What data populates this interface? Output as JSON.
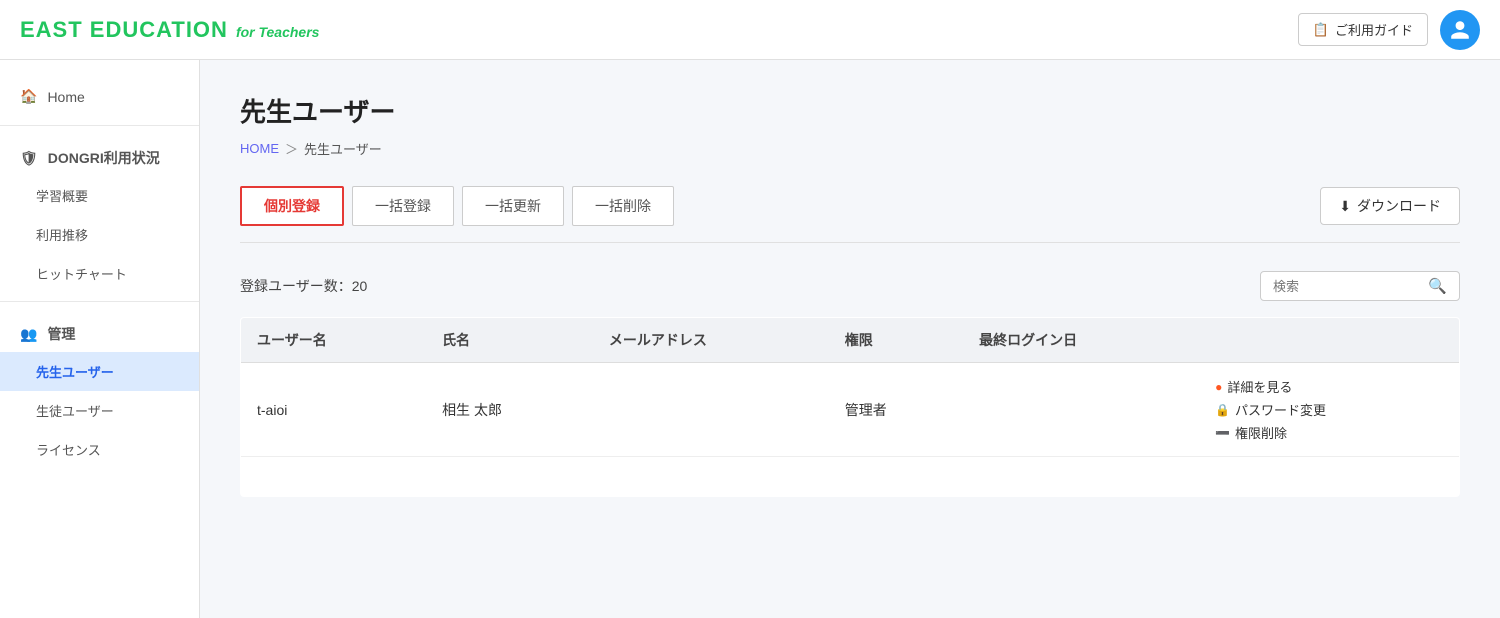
{
  "header": {
    "logo_main": "EAST EDUCATION",
    "logo_sub": "for Teachers",
    "guide_icon": "📋",
    "guide_label": "ご利用ガイド"
  },
  "sidebar": {
    "home_label": "Home",
    "dongri_label": "DONGRI利用状況",
    "sub_items": [
      {
        "label": "学習概要",
        "active": false
      },
      {
        "label": "利用推移",
        "active": false
      },
      {
        "label": "ヒットチャート",
        "active": false
      }
    ],
    "management_label": "管理",
    "management_sub": [
      {
        "label": "先生ユーザー",
        "active": true
      },
      {
        "label": "生徒ユーザー",
        "active": false
      },
      {
        "label": "ライセンス",
        "active": false
      }
    ]
  },
  "page": {
    "title": "先生ユーザー",
    "breadcrumb_home": "HOME",
    "breadcrumb_current": "先生ユーザー"
  },
  "tabs": [
    {
      "label": "個別登録",
      "active": true
    },
    {
      "label": "一括登録",
      "active": false
    },
    {
      "label": "一括更新",
      "active": false
    },
    {
      "label": "一括削除",
      "active": false
    }
  ],
  "download_label": "ダウンロード",
  "user_count_label": "登録ユーザー数：20",
  "search_placeholder": "検索",
  "table": {
    "columns": [
      "ユーザー名",
      "氏名",
      "メールアドレス",
      "権限",
      "最終ログイン日",
      ""
    ],
    "rows": [
      {
        "username": "t-aioi",
        "fullname": "相生 太郎",
        "email": "",
        "role": "管理者",
        "last_login": "",
        "actions": [
          "詳細を見る",
          "パスワード変更",
          "権限削除"
        ]
      }
    ]
  },
  "actions": {
    "detail": "詳細を見る",
    "password": "パスワード変更",
    "delete": "権限削除"
  }
}
